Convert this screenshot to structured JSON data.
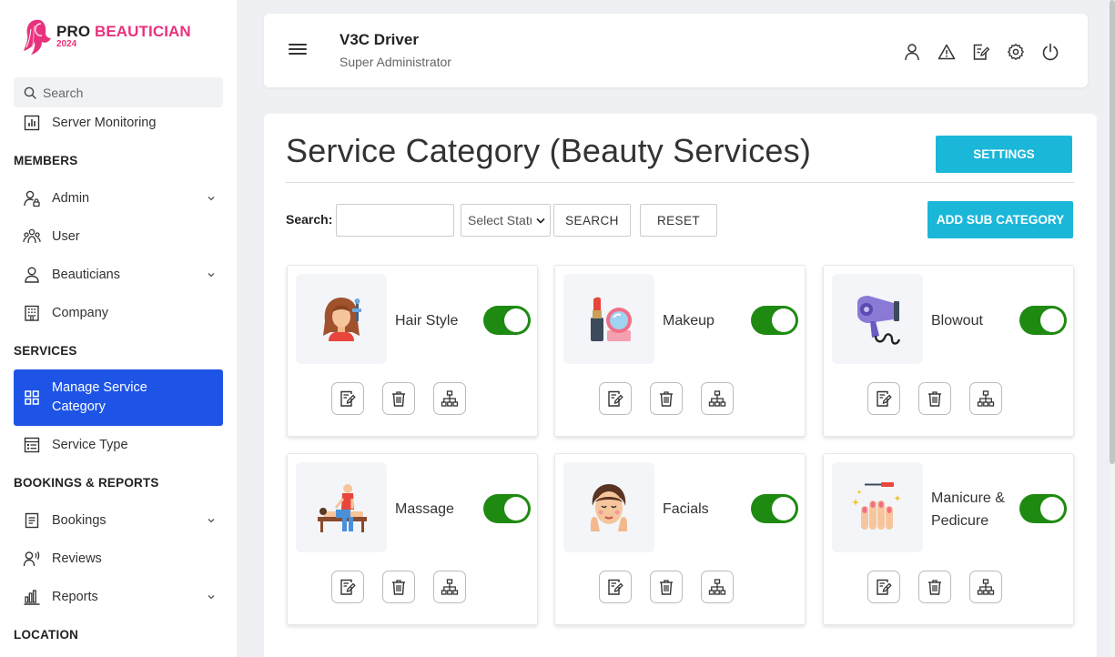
{
  "brand": {
    "name_part1": "PRO",
    "name_part2": "BEAUTICIAN",
    "year": "2024",
    "color": "#e8327d"
  },
  "sidebar": {
    "search_placeholder": "Search",
    "items": [
      {
        "label": "Server Monitoring",
        "icon": "chart-icon"
      },
      {
        "section": "MEMBERS"
      },
      {
        "label": "Admin",
        "icon": "user-lock-icon",
        "expandable": true
      },
      {
        "label": "User",
        "icon": "users-icon"
      },
      {
        "label": "Beauticians",
        "icon": "person-icon",
        "expandable": true
      },
      {
        "label": "Company",
        "icon": "building-icon"
      },
      {
        "section": "SERVICES"
      },
      {
        "label": "Manage Service Category",
        "icon": "grid-icon",
        "active": true
      },
      {
        "label": "Service Type",
        "icon": "list-icon"
      },
      {
        "section": "BOOKINGS & REPORTS"
      },
      {
        "label": "Bookings",
        "icon": "document-icon",
        "expandable": true
      },
      {
        "label": "Reviews",
        "icon": "review-icon"
      },
      {
        "label": "Reports",
        "icon": "bar-chart-icon",
        "expandable": true
      },
      {
        "section": "LOCATION"
      }
    ],
    "active_color": "#1d54e6"
  },
  "header": {
    "user_name": "V3C Driver",
    "user_role": "Super Administrator",
    "icons": [
      "profile-icon",
      "alert-icon",
      "edit-icon",
      "settings-icon",
      "power-icon"
    ]
  },
  "main": {
    "title": "Service Category (Beauty Services)",
    "settings_label": "SETTINGS",
    "add_label": "ADD SUB CATEGORY",
    "search_label": "Search:",
    "search_value": "",
    "status_select": "Select Status",
    "search_button": "SEARCH",
    "reset_button": "RESET",
    "accent_color": "#1bb7d9",
    "toggle_color": "#1e8a12",
    "categories": [
      {
        "name": "Hair Style",
        "active": true,
        "icon": "hair-style-icon"
      },
      {
        "name": "Makeup",
        "active": true,
        "icon": "makeup-icon"
      },
      {
        "name": "Blowout",
        "active": true,
        "icon": "hair-dryer-icon"
      },
      {
        "name": "Massage",
        "active": true,
        "icon": "massage-icon"
      },
      {
        "name": "Facials",
        "active": true,
        "icon": "facial-icon"
      },
      {
        "name": "Manicure & Pedicure",
        "active": true,
        "icon": "manicure-icon"
      }
    ]
  }
}
